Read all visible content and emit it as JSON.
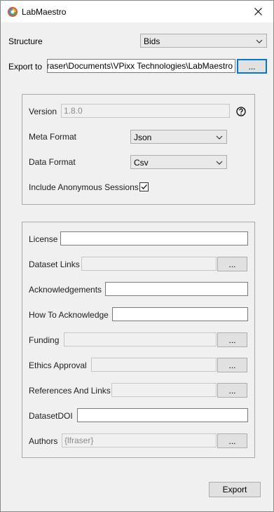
{
  "window": {
    "title": "LabMaestro"
  },
  "top": {
    "structure_label": "Structure",
    "structure_value": "Bids",
    "export_to_label": "Export to",
    "export_to_value": "raser\\Documents\\VPixx Technologies\\LabMaestro",
    "browse_label": "..."
  },
  "format": {
    "version_label": "Version",
    "version_placeholder": "1.8.0",
    "meta_format_label": "Meta Format",
    "meta_format_value": "Json",
    "data_format_label": "Data Format",
    "data_format_value": "Csv",
    "include_anon_label": "Include Anonymous Sessions",
    "include_anon_checked": true
  },
  "meta": {
    "license_label": "License",
    "license_value": "",
    "dataset_links_label": "Dataset Links",
    "acknowledgements_label": "Acknowledgements",
    "acknowledgements_value": "",
    "how_to_ack_label": "How To Acknowledge",
    "how_to_ack_value": "",
    "funding_label": "Funding",
    "ethics_label": "Ethics Approval",
    "refs_label": "References And Links",
    "doi_label": "DatasetDOI",
    "doi_value": "",
    "authors_label": "Authors",
    "authors_placeholder": "{lfraser}",
    "browse_label": "..."
  },
  "actions": {
    "export_label": "Export"
  },
  "icons": {
    "app": "labmaestro-app-icon",
    "close": "close-icon",
    "help": "help-icon",
    "chevron": "chevron-down-icon",
    "check": "checkmark-icon"
  }
}
